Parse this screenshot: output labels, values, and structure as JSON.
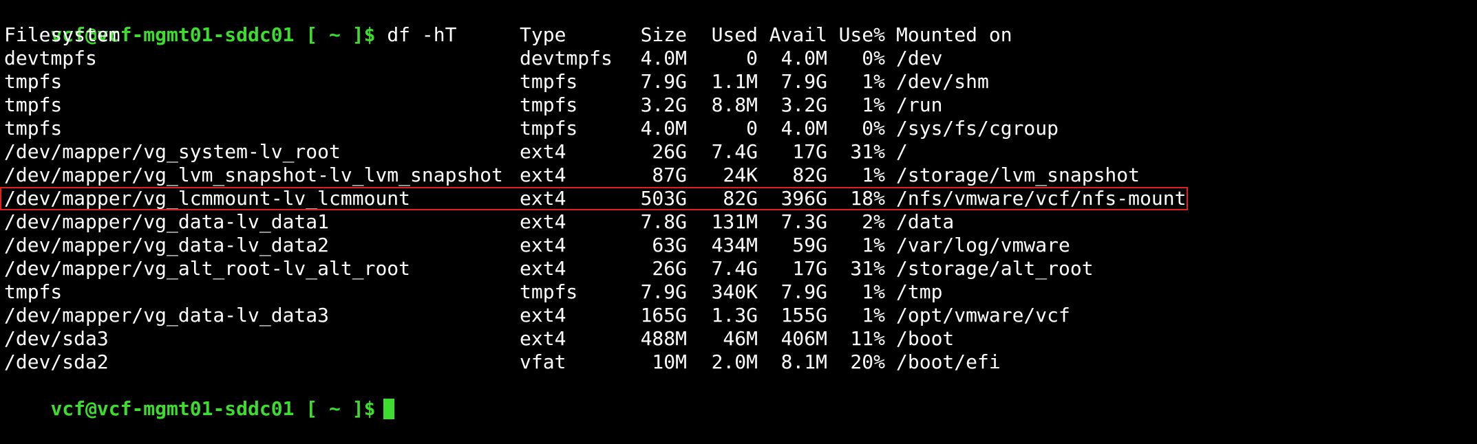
{
  "prompt": "vcf@vcf-mgmt01-sddc01 [ ~ ]$",
  "command": "df -hT",
  "header": {
    "filesystem": "Filesystem",
    "type": "Type",
    "size": "Size",
    "used": "Used",
    "avail": "Avail",
    "use_pct": "Use%",
    "mounted_on": "Mounted on"
  },
  "rows": [
    {
      "filesystem": "devtmpfs",
      "type": "devtmpfs",
      "size": "4.0M",
      "used": "0",
      "avail": "4.0M",
      "use_pct": "0%",
      "mounted_on": "/dev"
    },
    {
      "filesystem": "tmpfs",
      "type": "tmpfs",
      "size": "7.9G",
      "used": "1.1M",
      "avail": "7.9G",
      "use_pct": "1%",
      "mounted_on": "/dev/shm"
    },
    {
      "filesystem": "tmpfs",
      "type": "tmpfs",
      "size": "3.2G",
      "used": "8.8M",
      "avail": "3.2G",
      "use_pct": "1%",
      "mounted_on": "/run"
    },
    {
      "filesystem": "tmpfs",
      "type": "tmpfs",
      "size": "4.0M",
      "used": "0",
      "avail": "4.0M",
      "use_pct": "0%",
      "mounted_on": "/sys/fs/cgroup"
    },
    {
      "filesystem": "/dev/mapper/vg_system-lv_root",
      "type": "ext4",
      "size": "26G",
      "used": "7.4G",
      "avail": "17G",
      "use_pct": "31%",
      "mounted_on": "/"
    },
    {
      "filesystem": "/dev/mapper/vg_lvm_snapshot-lv_lvm_snapshot",
      "type": "ext4",
      "size": "87G",
      "used": "24K",
      "avail": "82G",
      "use_pct": "1%",
      "mounted_on": "/storage/lvm_snapshot"
    },
    {
      "filesystem": "/dev/mapper/vg_lcmmount-lv_lcmmount",
      "type": "ext4",
      "size": "503G",
      "used": "82G",
      "avail": "396G",
      "use_pct": "18%",
      "mounted_on": "/nfs/vmware/vcf/nfs-mount"
    },
    {
      "filesystem": "/dev/mapper/vg_data-lv_data1",
      "type": "ext4",
      "size": "7.8G",
      "used": "131M",
      "avail": "7.3G",
      "use_pct": "2%",
      "mounted_on": "/data"
    },
    {
      "filesystem": "/dev/mapper/vg_data-lv_data2",
      "type": "ext4",
      "size": "63G",
      "used": "434M",
      "avail": "59G",
      "use_pct": "1%",
      "mounted_on": "/var/log/vmware"
    },
    {
      "filesystem": "/dev/mapper/vg_alt_root-lv_alt_root",
      "type": "ext4",
      "size": "26G",
      "used": "7.4G",
      "avail": "17G",
      "use_pct": "31%",
      "mounted_on": "/storage/alt_root"
    },
    {
      "filesystem": "tmpfs",
      "type": "tmpfs",
      "size": "7.9G",
      "used": "340K",
      "avail": "7.9G",
      "use_pct": "1%",
      "mounted_on": "/tmp"
    },
    {
      "filesystem": "/dev/mapper/vg_data-lv_data3",
      "type": "ext4",
      "size": "165G",
      "used": "1.3G",
      "avail": "155G",
      "use_pct": "1%",
      "mounted_on": "/opt/vmware/vcf"
    },
    {
      "filesystem": "/dev/sda3",
      "type": "ext4",
      "size": "488M",
      "used": "46M",
      "avail": "406M",
      "use_pct": "11%",
      "mounted_on": "/boot"
    },
    {
      "filesystem": "/dev/sda2",
      "type": "vfat",
      "size": "10M",
      "used": "2.0M",
      "avail": "8.1M",
      "use_pct": "20%",
      "mounted_on": "/boot/efi"
    }
  ],
  "colors": {
    "background": "#000000",
    "text": "#ffffff",
    "prompt": "#3ddc2f",
    "highlight_box": "#e02020"
  }
}
